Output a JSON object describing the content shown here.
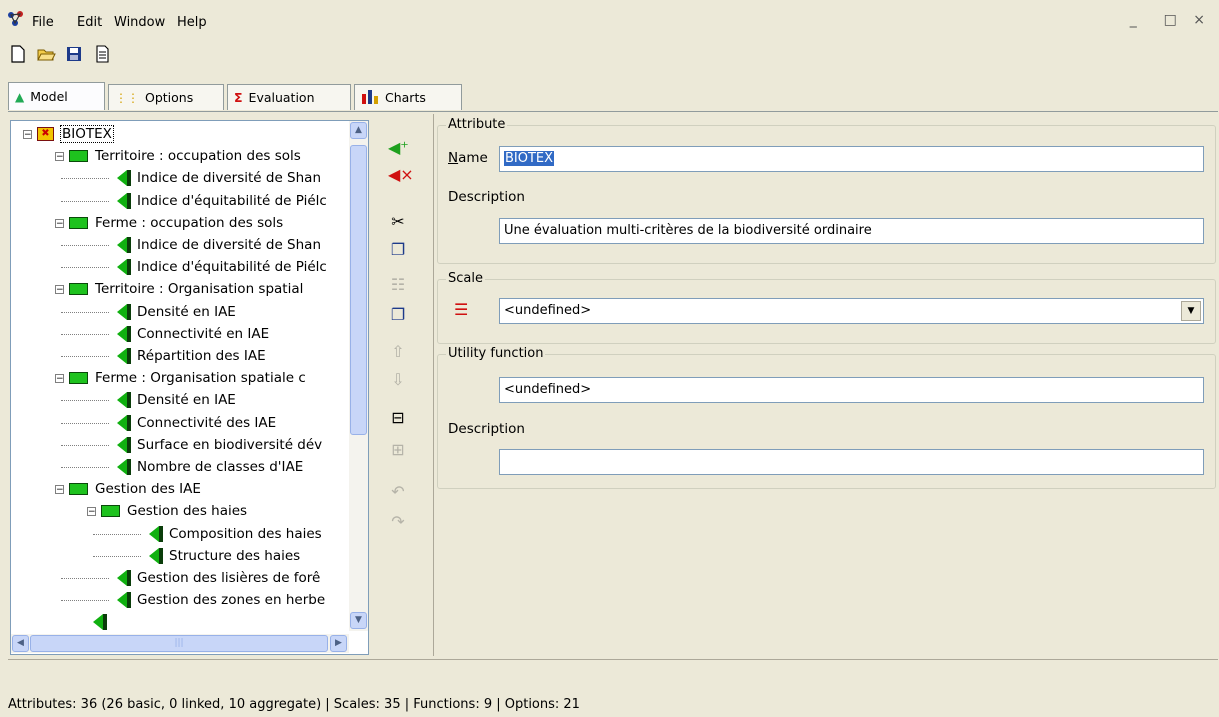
{
  "menu": {
    "items": [
      "File",
      "Edit",
      "Window",
      "Help"
    ]
  },
  "window_controls": "_  □ ×",
  "tabs": [
    {
      "label": "Model",
      "icon": "model-tree-icon"
    },
    {
      "label": "Options",
      "icon": "options-dots-icon"
    },
    {
      "label": "Evaluation",
      "icon": "sigma-icon"
    },
    {
      "label": "Charts",
      "icon": "bar-chart-icon"
    }
  ],
  "tree": {
    "root": "BIOTEX",
    "rows": [
      {
        "label": "Territoire : occupation des sols",
        "level": 1,
        "type": "aggregate"
      },
      {
        "label": "Indice de diversité de Shan",
        "level": 2,
        "type": "leaf"
      },
      {
        "label": "Indice d'équitabilité de Piélc",
        "level": 2,
        "type": "leaf"
      },
      {
        "label": "Ferme : occupation des sols",
        "level": 1,
        "type": "aggregate"
      },
      {
        "label": "Indice de diversité de Shan",
        "level": 2,
        "type": "leaf"
      },
      {
        "label": "Indice d'équitabilité de Piélc",
        "level": 2,
        "type": "leaf"
      },
      {
        "label": "Territoire : Organisation spatial",
        "level": 1,
        "type": "aggregate"
      },
      {
        "label": "Densité en IAE",
        "level": 2,
        "type": "leaf"
      },
      {
        "label": "Connectivité en IAE",
        "level": 2,
        "type": "leaf"
      },
      {
        "label": "Répartition des IAE",
        "level": 2,
        "type": "leaf"
      },
      {
        "label": "Ferme : Organisation spatiale c",
        "level": 1,
        "type": "aggregate"
      },
      {
        "label": "Densité en IAE",
        "level": 2,
        "type": "leaf"
      },
      {
        "label": "Connectivité des IAE",
        "level": 2,
        "type": "leaf"
      },
      {
        "label": "Surface en biodiversité dév",
        "level": 2,
        "type": "leaf"
      },
      {
        "label": "Nombre de classes d'IAE",
        "level": 2,
        "type": "leaf"
      },
      {
        "label": "Gestion des IAE",
        "level": 1,
        "type": "aggregate"
      },
      {
        "label": "Gestion des haies",
        "level": 2,
        "type": "aggregate"
      },
      {
        "label": "Composition des haies",
        "level": 3,
        "type": "leaf"
      },
      {
        "label": "Structure des haies",
        "level": 3,
        "type": "leaf"
      },
      {
        "label": "Gestion des lisières de forê",
        "level": 2,
        "type": "leaf"
      },
      {
        "label": "Gestion des zones en herbe",
        "level": 2,
        "type": "leaf"
      }
    ]
  },
  "attribute": {
    "group_label": "Attribute",
    "name_label": "Name",
    "name_value": "BIOTEX",
    "description_label": "Description",
    "description_value": "Une évaluation multi-critères de la biodiversité ordinaire"
  },
  "scale": {
    "group_label": "Scale",
    "value": "<undefined>"
  },
  "utility": {
    "group_label": "Utility function",
    "value": "<undefined>",
    "description_label": "Description",
    "description_value": ""
  },
  "status": {
    "text": "Attributes: 36 (26 basic, 0 linked, 10 aggregate)   |   Scales: 35   |   Functions: 9   |   Options: 21"
  },
  "colors": {
    "background": "#ece9d8",
    "aggregate": "#1ec21e",
    "selection": "#316ac5"
  }
}
